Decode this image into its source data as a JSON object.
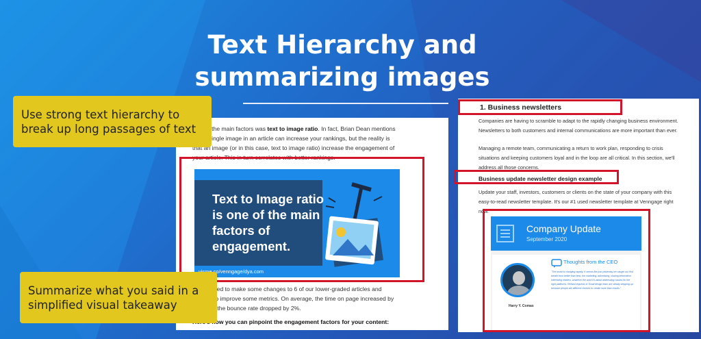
{
  "slide": {
    "title_line1": "Text Hierarchy and",
    "title_line2": "summarizing images"
  },
  "callouts": {
    "top": "Use strong text hierarchy to break up long passages of text",
    "bottom": "Summarize what you said in a simplified visual takeaway"
  },
  "left_article": {
    "para1_pre": "One of the main factors was ",
    "para1_bold": "text to image ratio",
    "para1_post": ". In fact, Brian Dean mentions that a single image in an article can increase your rankings, but the reality is that an image (or in this case, text to image ratio) increase the engagement of your article. This in turn correlates with better rankings.",
    "ad_text": "Text to Image ratio is one of the main factors of engagement.",
    "ad_brand": "visme.co/venngage/dya.com",
    "para2": "We decided to make some changes to 6 of our lower-graded articles and attempt to improve some metrics. On average, the time on page increased by 24% and the bounce rate dropped by 2%.",
    "para3": "Here's how you can pinpoint the engagement factors for your content:"
  },
  "right_article": {
    "heading": "1. Business newsletters",
    "para1": "Companies are having to scramble to adapt to the rapidly changing business environment. Newsletters to both customers and internal communications are more important than ever.",
    "para2": "Managing a remote team, communicating a return to work plan, responding to crisis situations and keeping customers loyal and in the loop are all critical. In this section, we'll address all those concerns.",
    "subheading": "Business update newsletter design example",
    "para3": "Update your staff, investors, customers or clients on the state of your company with this easy-to-read newsletter template. It's our #1 used newsletter template at Venngage right now.",
    "newsletter": {
      "title": "Company Update",
      "date": "September 2020",
      "section": "Thoughts from the CEO",
      "body": "\"The world is changing rapidly. It seems like just yesterday we caught our first breath from better than best, the marketing, advertising, sharing information interesting readers, whatever the work it's about addressing causes for the right platforms. Refund requests in Small design team are steady stepping up because people are different choices to create more than results.\"",
      "name": "Harry Y. Comas"
    }
  },
  "colors": {
    "callout": "#e2c81e",
    "highlight": "#d2142a",
    "ad_blue": "#1b8ae9",
    "ad_dark": "#214d7c"
  }
}
